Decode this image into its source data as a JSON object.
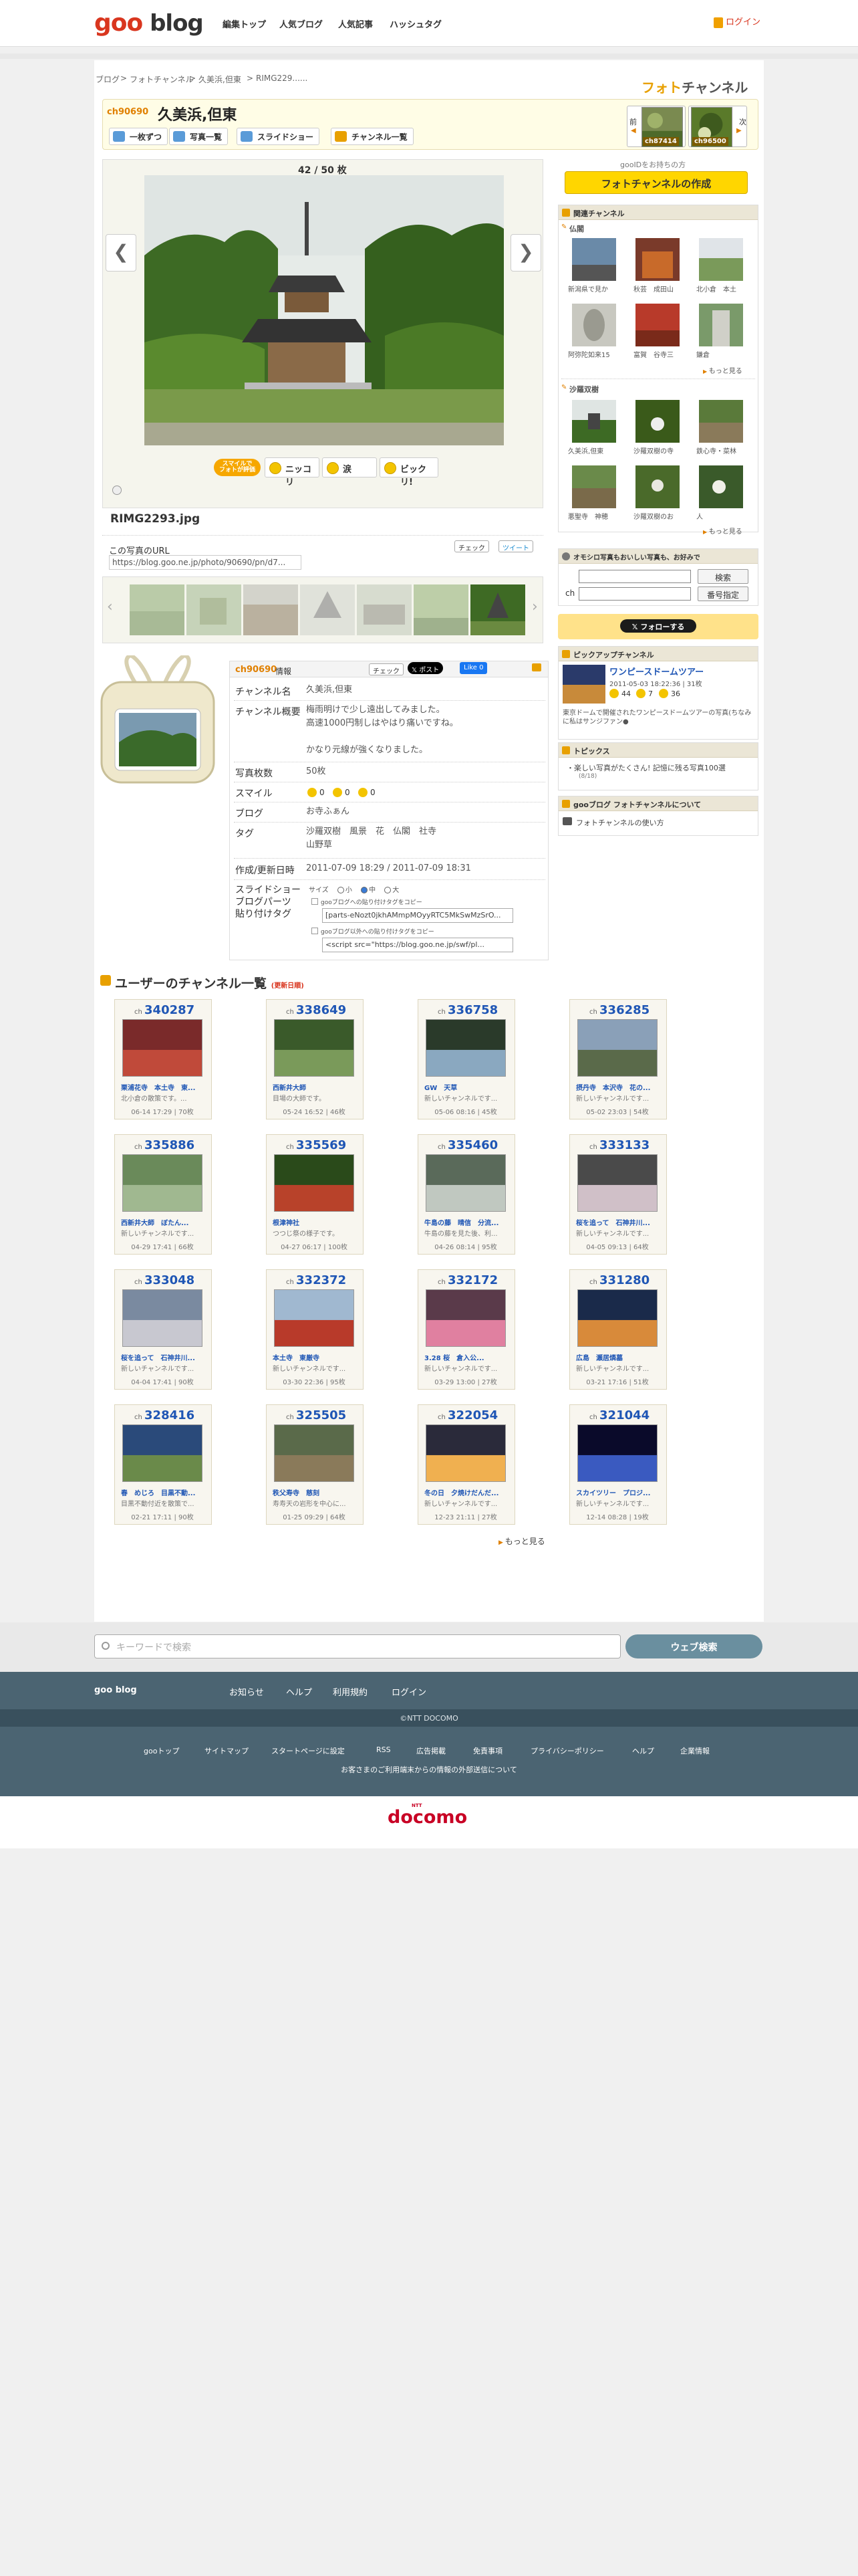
{
  "header": {
    "logo_goo": "goo",
    "logo_blog": "blog",
    "nav": [
      "編集トップ",
      "人気ブログ",
      "人気記事",
      "ハッシュタグ"
    ],
    "login": "ログイン"
  },
  "breadcrumb": [
    "ブログ",
    "フォトチャンネル",
    "久美浜,但東",
    "RIMG229......"
  ],
  "photo_channel_title_1": "フォト",
  "photo_channel_title_2": "チャンネル",
  "channel": {
    "number": "ch90690",
    "name": "久美浜,但東",
    "buttons": [
      "一枚ずつ",
      "写真一覧",
      "スライドショー",
      "チャンネル一覧"
    ],
    "prev_label": "前",
    "next_label": "次",
    "prev_channel": "ch87414",
    "next_channel": "ch96500"
  },
  "photo": {
    "count": "42 / 50 枚",
    "filename": "RIMG2293.jpg",
    "url_label": "この写真のURL",
    "url": "https://blog.goo.ne.jp/photo/90690/pn/d7...",
    "reaction_badge_line1": "スマイルで",
    "reaction_badge_line2": "フォトが評価",
    "reactions": [
      "ニッコリ",
      "涙",
      "ビックリ!"
    ],
    "check_label": "チェック",
    "tweet_label": "ツイート"
  },
  "sidebar": {
    "gooid_text": "gooIDをお持ちの方",
    "create_button": "フォトチャンネルの作成",
    "related_title": "関連チャンネル",
    "related_group1": "仏閣",
    "related1": [
      "新潟県で見か",
      "秋芸　成田山",
      "北小倉　本土",
      "阿弥陀如来15",
      "富賀　谷寺三",
      "鎌倉"
    ],
    "related_group2": "沙羅双樹",
    "related2": [
      "久美浜,但東",
      "沙羅双樹の寺",
      "鉄心寺・菜林",
      "悪聖寺　神穂",
      "沙羅双樹のお",
      "人"
    ],
    "more": "もっと見る",
    "search_title": "オモシロ写真もおいしい写真も、お好みで",
    "search_button": "検索",
    "number_button": "番号指定",
    "ch_label": "ch",
    "follow": "フォローする",
    "pickup_title": "ピックアップチャンネル",
    "pickup_name": "ワンピースドームツアー",
    "pickup_date": "2011-05-03 18:22:36 | 31枚",
    "pickup_stats": [
      "44",
      "7",
      "36"
    ],
    "pickup_desc": "東京ドームで開催されたワンピースドームツアーの写真(ちなみに私はサンジファン●",
    "topics_title": "トピックス",
    "topics_item": "楽しい写真がたくさん! 記憶に残る写真100選",
    "topics_sub": "(8/18)",
    "about_title": "gooブログ フォトチャンネルについて",
    "about_item": "フォトチャンネルの使い方"
  },
  "info": {
    "number": "ch90690",
    "title_suffix": "情報",
    "check_label": "チェック",
    "post_label": "ポスト",
    "like_label": "Like 0",
    "rows": [
      {
        "label": "チャンネル名",
        "value": "久美浜,但東"
      },
      {
        "label": "チャンネル概要",
        "value": "梅雨明けで少し遠出してみました。\n高速1000円制しはやはり痛いですね。\n\nかなり元線が強くなりました。"
      },
      {
        "label": "写真枚数",
        "value": "50枚"
      },
      {
        "label": "スマイル",
        "value": ""
      },
      {
        "label": "ブログ",
        "value": "お寺ふぁん"
      },
      {
        "label": "タグ",
        "value": "沙羅双樹　風景　花　仏閣　社寺\n山野草"
      },
      {
        "label": "作成/更新日時",
        "value": "2011-07-09 18:29 / 2011-07-09 18:31"
      },
      {
        "label": "スライドショー\nブログパーツ\n貼り付けタグ",
        "value": ""
      }
    ],
    "smile_counts": [
      "0",
      "0",
      "0"
    ],
    "size_label": "サイズ",
    "sizes": [
      "小",
      "中",
      "大"
    ],
    "tag1_label": "gooブログへの貼り付けタグをコピー",
    "tag1_value": "[parts-eNozt0jkhAMmpMOyyRTC5MkSwMzSrO...",
    "tag2_label": "gooブログ以外への貼り付けタグをコピー",
    "tag2_value": "<script src=\"https://blog.goo.ne.jp/swf/pl..."
  },
  "user_channels": {
    "title": "ユーザーのチャンネル一覧",
    "subtitle": "(更新日順)",
    "ch_prefix": "ch",
    "items": [
      {
        "num": "340287",
        "title": "栗浦花寺　本土寺　東...",
        "desc": "北小倉の散策です。...",
        "date": "06-14 17:29 | 70枚"
      },
      {
        "num": "338649",
        "title": "西新井大師",
        "desc": "目場の大師です。",
        "date": "05-24 16:52 | 46枚"
      },
      {
        "num": "336758",
        "title": "GW　天草",
        "desc": "新しいチャンネルです...",
        "date": "05-06 08:16 | 45枚"
      },
      {
        "num": "336285",
        "title": "摂丹寺　本沢寺　花の...",
        "desc": "新しいチャンネルです...",
        "date": "05-02 23:03 | 54枚"
      },
      {
        "num": "335886",
        "title": "西新井大師　ぼたん...",
        "desc": "新しいチャンネルです...",
        "date": "04-29 17:41 | 66枚"
      },
      {
        "num": "335569",
        "title": "根津神社",
        "desc": "つつじ祭の様子です。",
        "date": "04-27 06:17 | 100枚"
      },
      {
        "num": "335460",
        "title": "牛島の藤　晴信　分流...",
        "desc": "牛島の藤を見た後、利...",
        "date": "04-26 08:14 | 95枚"
      },
      {
        "num": "333133",
        "title": "桜を追って　石神井川...",
        "desc": "新しいチャンネルです...",
        "date": "04-05 09:13 | 64枚"
      },
      {
        "num": "333048",
        "title": "桜を追って　石神井川...",
        "desc": "新しいチャンネルです...",
        "date": "04-04 17:41 | 90枚"
      },
      {
        "num": "332372",
        "title": "本土寺　東厳寺",
        "desc": "新しいチャンネルです...",
        "date": "03-30 22:36 | 95枚"
      },
      {
        "num": "332172",
        "title": "3.28 桜　倉入公...",
        "desc": "新しいチャンネルです...",
        "date": "03-29 13:00 | 27枚"
      },
      {
        "num": "331280",
        "title": "広島　瀬居燐墓",
        "desc": "新しいチャンネルです...",
        "date": "03-21 17:16 | 51枚"
      },
      {
        "num": "328416",
        "title": "春　めじろ　目黒不動...",
        "desc": "目黒不動付近を散策で...",
        "date": "02-21 17:11 | 90枚"
      },
      {
        "num": "325505",
        "title": "秩父寿寺　慈刻",
        "desc": "寿寿天の岩形を中心に...",
        "date": "01-25 09:29 | 64枚"
      },
      {
        "num": "322054",
        "title": "冬の日　夕焼けだんだ...",
        "desc": "新しいチャンネルです...",
        "date": "12-23 21:11 | 27枚"
      },
      {
        "num": "321044",
        "title": "スカイツリー　プロジ...",
        "desc": "新しいチャンネルです...",
        "date": "12-14 08:28 | 19枚"
      }
    ],
    "more": "もっと見る"
  },
  "footer": {
    "search_placeholder": "キーワードで検索",
    "web_search": "ウェブ検索",
    "goo_blog": "goo blog",
    "links1": [
      "お知らせ",
      "ヘルプ",
      "利用規約",
      "ログイン"
    ],
    "copyright": "©NTT DOCOMO",
    "links2": [
      "gooトップ",
      "サイトマップ",
      "スタートページに設定",
      "RSS",
      "広告掲載",
      "免責事項",
      "プライバシーポリシー",
      "ヘルプ",
      "企業情報"
    ],
    "notice": "お客さまのご利用端末からの情報の外部送信について",
    "docomo": "docomo",
    "docomo_small": "NTT"
  }
}
